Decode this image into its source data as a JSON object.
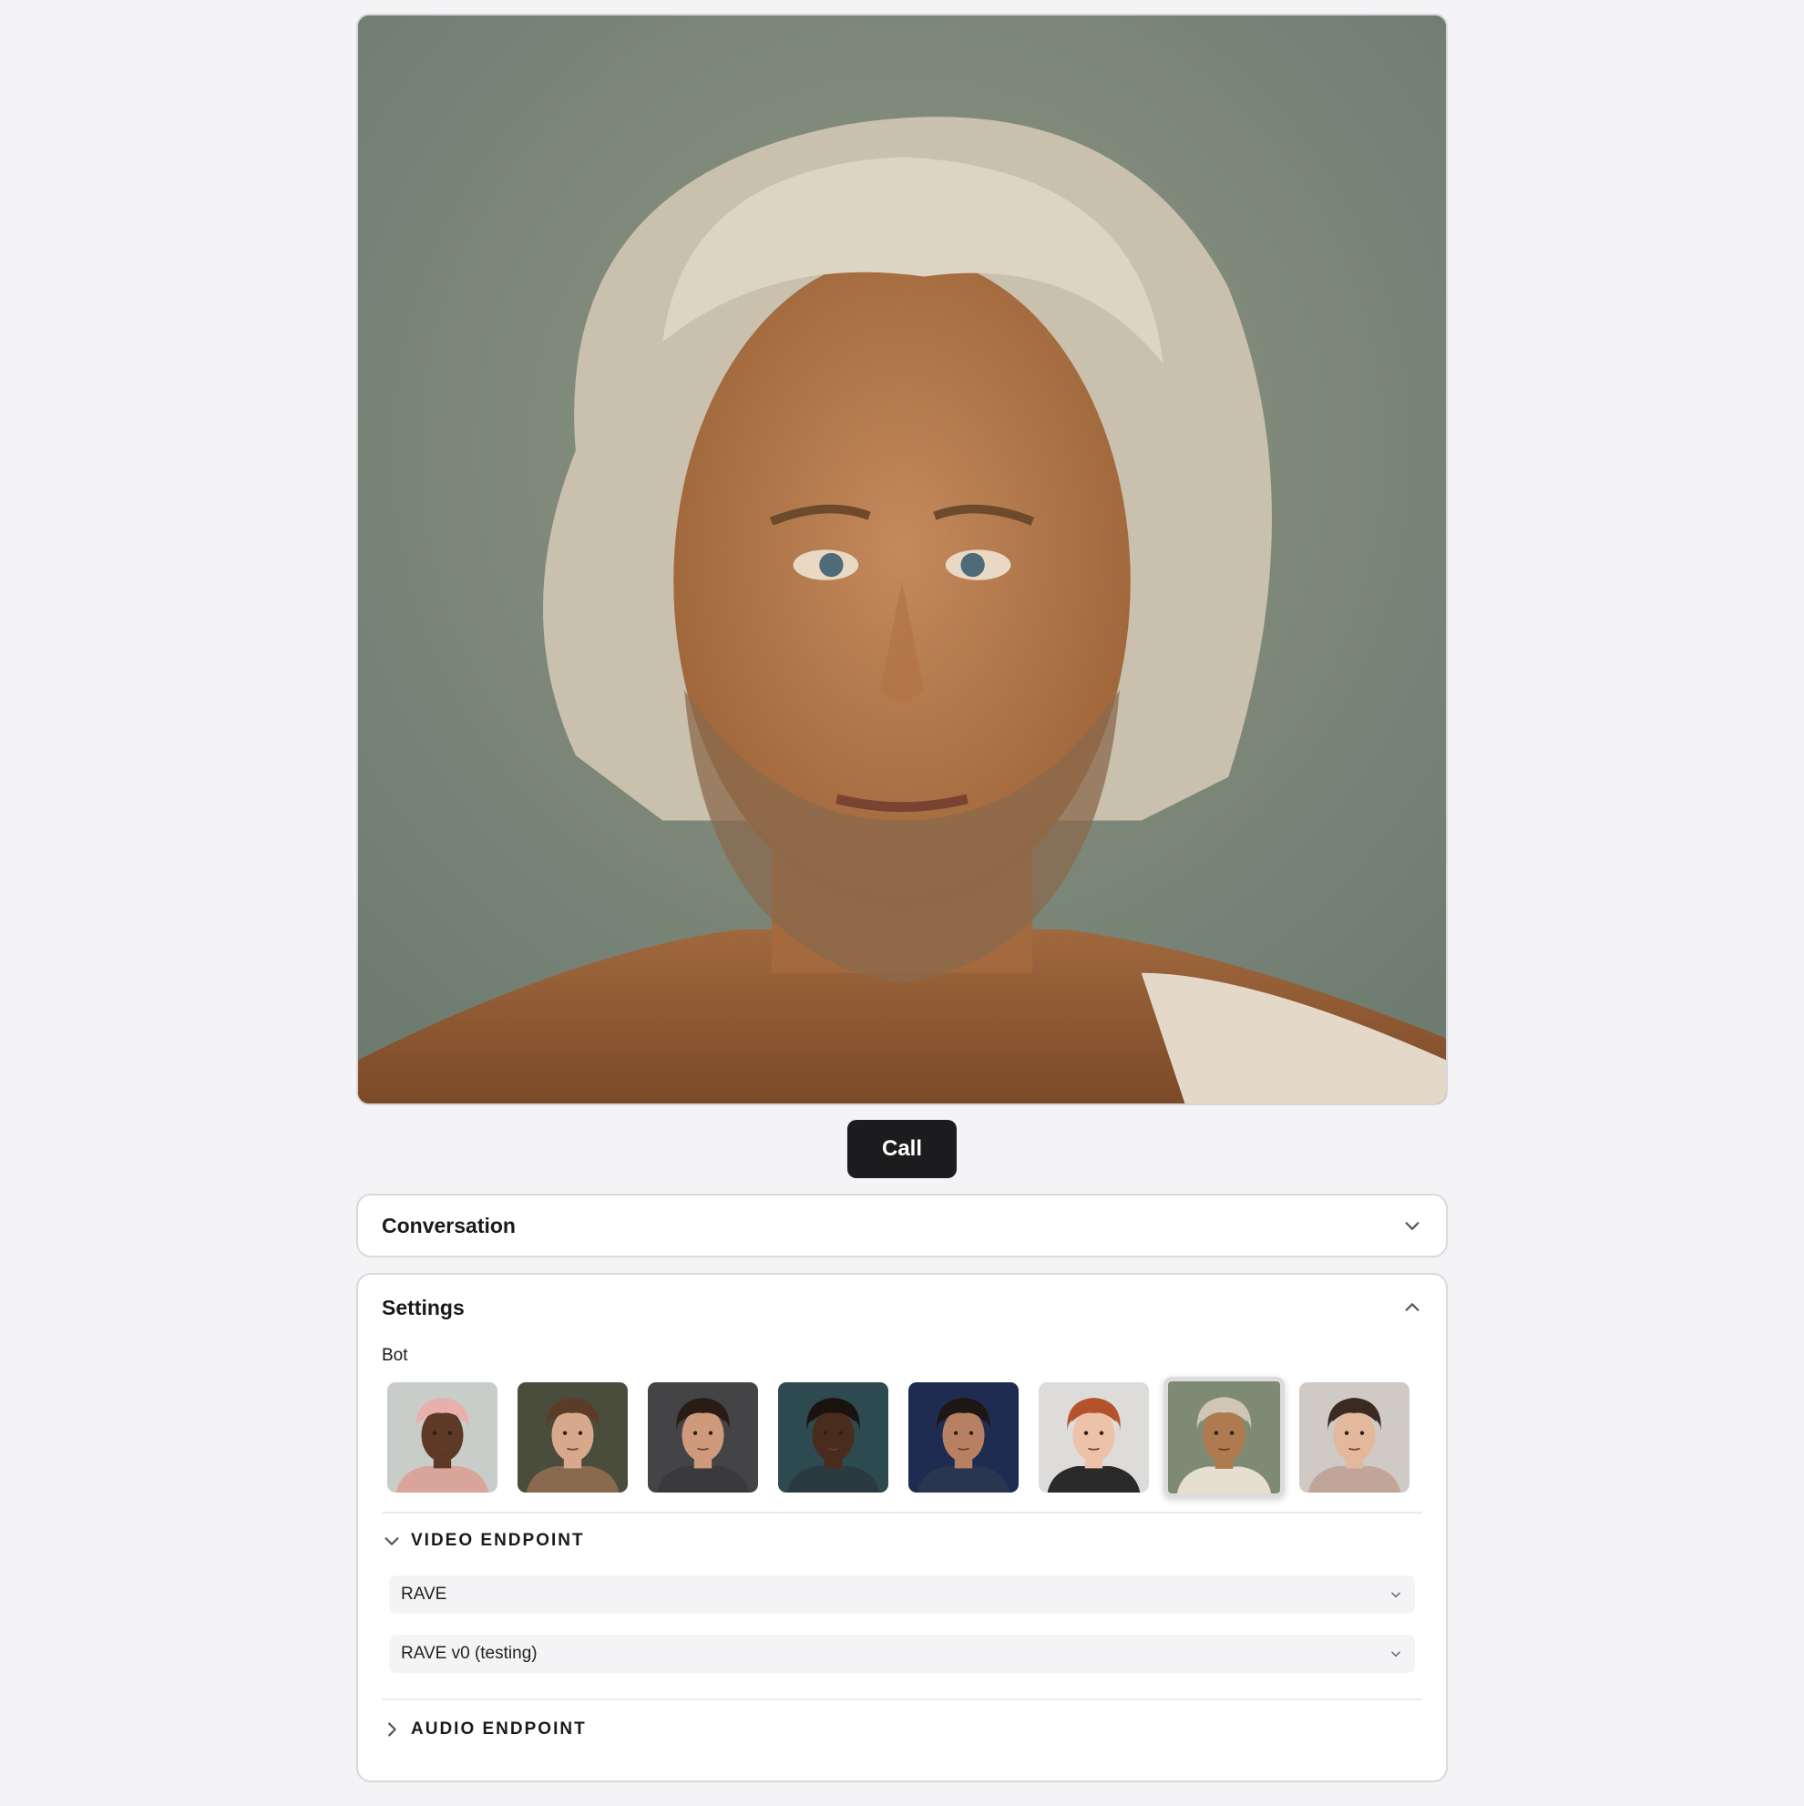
{
  "call_button": "Call",
  "conversation": {
    "title": "Conversation"
  },
  "settings": {
    "title": "Settings",
    "bot_label": "Bot",
    "bots": [
      {
        "name": "bot-1",
        "bg": "#c9cdca",
        "skin": "#5e3a26",
        "hair": "#e7b0ad",
        "shirt": "#d9a59b"
      },
      {
        "name": "bot-2",
        "bg": "#4b4d3c",
        "skin": "#d8a88c",
        "hair": "#5a3c28",
        "shirt": "#8a6a4e"
      },
      {
        "name": "bot-3",
        "bg": "#444446",
        "skin": "#cf9a7c",
        "hair": "#2a1c14",
        "shirt": "#3a3a3c"
      },
      {
        "name": "bot-4",
        "bg": "#2d4a50",
        "skin": "#4a2c1e",
        "hair": "#1a120e",
        "shirt": "#2a3a40"
      },
      {
        "name": "bot-5",
        "bg": "#1f2c52",
        "skin": "#b88062",
        "hair": "#1e1612",
        "shirt": "#2a3550"
      },
      {
        "name": "bot-6",
        "bg": "#dedcda",
        "skin": "#ecc2a8",
        "hair": "#b4522c",
        "shirt": "#2a2a2a"
      },
      {
        "name": "bot-7",
        "bg": "#7f8a74",
        "skin": "#b07a50",
        "hair": "#cfc7b4",
        "shirt": "#e6ded0"
      },
      {
        "name": "bot-8",
        "bg": "#cfcac6",
        "skin": "#e4b89c",
        "hair": "#3a2a22",
        "shirt": "#c2a59a"
      }
    ],
    "selected_bot": 6,
    "video_endpoint": {
      "label": "VIDEO ENDPOINT",
      "provider": "RAVE",
      "model": "RAVE v0 (testing)"
    },
    "audio_endpoint": {
      "label": "AUDIO ENDPOINT"
    }
  }
}
